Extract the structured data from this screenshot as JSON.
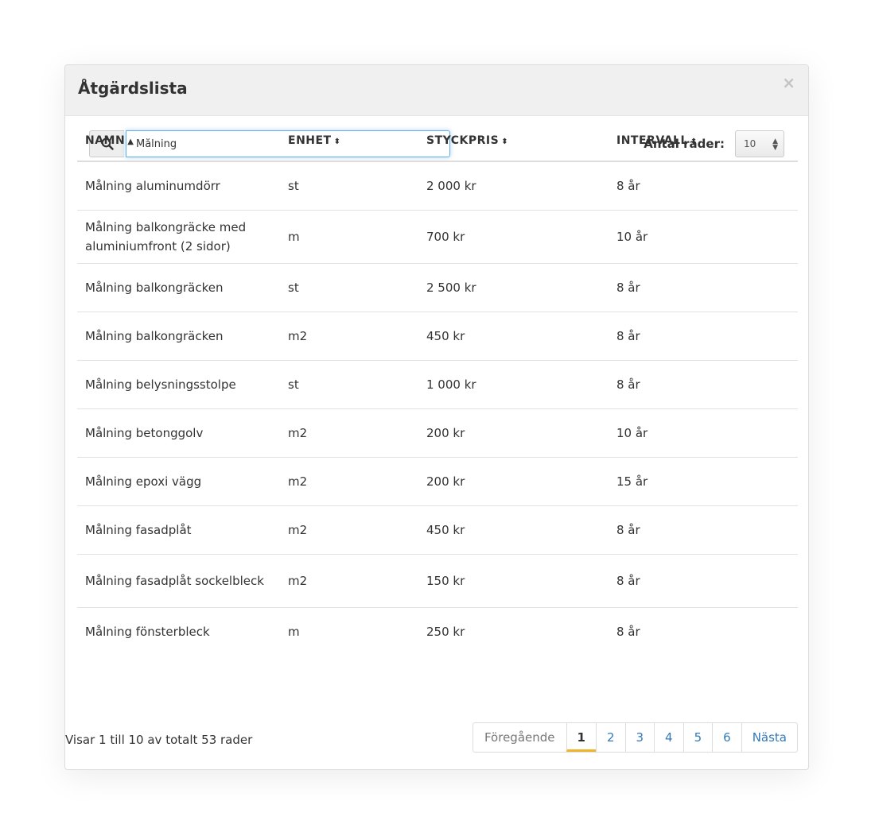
{
  "modal": {
    "title": "Åtgärdslista",
    "close_label": "×"
  },
  "search": {
    "value": "Målning",
    "icon": "search-icon"
  },
  "rows_control": {
    "label": "Antal rader:",
    "selected": "10"
  },
  "table": {
    "headers": [
      {
        "label": "NAMN",
        "sort": "▲"
      },
      {
        "label": "ENHET",
        "sort": "⬍"
      },
      {
        "label": "STYCKPRIS",
        "sort": "⬍"
      },
      {
        "label": "INTERVALL",
        "sort": "⬍"
      }
    ],
    "rows": [
      {
        "name": "Målning aluminumdörr",
        "unit": "st",
        "price": "2 000 kr",
        "interval": "8 år"
      },
      {
        "name": "Målning balkongräcke med aluminiumfront (2 sidor)",
        "unit": "m",
        "price": "700 kr",
        "interval": "10 år"
      },
      {
        "name": "Målning balkongräcken",
        "unit": "st",
        "price": "2 500 kr",
        "interval": "8 år"
      },
      {
        "name": "Målning balkongräcken",
        "unit": "m2",
        "price": "450 kr",
        "interval": "8 år"
      },
      {
        "name": "Målning belysningsstolpe",
        "unit": "st",
        "price": "1 000 kr",
        "interval": "8 år"
      },
      {
        "name": "Målning betonggolv",
        "unit": "m2",
        "price": "200 kr",
        "interval": "10 år"
      },
      {
        "name": "Målning epoxi vägg",
        "unit": "m2",
        "price": "200 kr",
        "interval": "15 år"
      },
      {
        "name": "Målning fasadplåt",
        "unit": "m2",
        "price": "450 kr",
        "interval": "8 år"
      },
      {
        "name": "Målning fasadplåt sockelbleck",
        "unit": "m2",
        "price": "150 kr",
        "interval": "8 år"
      },
      {
        "name": "Målning fönsterbleck",
        "unit": "m",
        "price": "250 kr",
        "interval": "8 år"
      }
    ]
  },
  "footer": {
    "info": "Visar 1 till 10 av totalt 53 rader",
    "pagination": {
      "prev": "Föregående",
      "pages": [
        "1",
        "2",
        "3",
        "4",
        "5",
        "6"
      ],
      "active": "1",
      "next": "Nästa"
    }
  },
  "colors": {
    "accent": "#f0b429",
    "link": "#337ab7",
    "focus": "#66afe9"
  }
}
